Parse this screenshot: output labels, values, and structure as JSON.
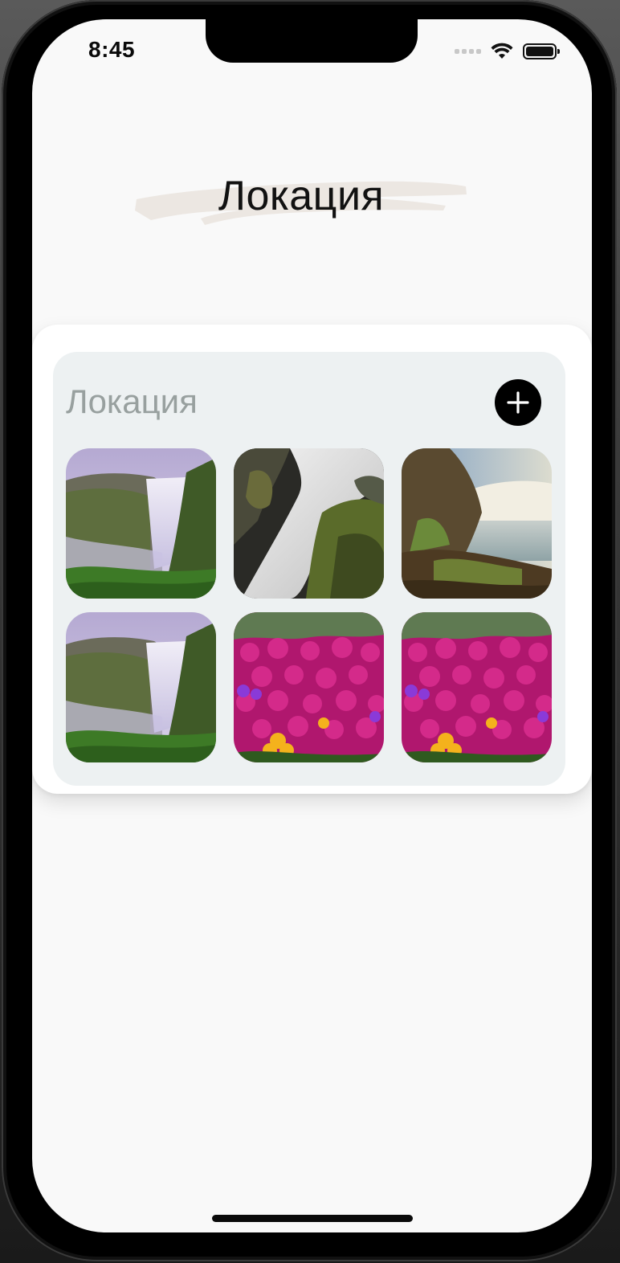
{
  "status_bar": {
    "time": "8:45"
  },
  "header": {
    "title": "Локация"
  },
  "location_card": {
    "title": "Локация",
    "add_button_icon": "plus-icon",
    "photos": [
      {
        "subject": "misty waterfall with green cliffs"
      },
      {
        "subject": "long-exposure white water over mossy rocks"
      },
      {
        "subject": "waterfall over lake with rocky shore"
      },
      {
        "subject": "misty waterfall with green cliffs"
      },
      {
        "subject": "magenta flower field with yellow blooms"
      },
      {
        "subject": "magenta flower field with yellow blooms"
      }
    ]
  },
  "colors": {
    "screen_bg": "#f9f9f9",
    "panel_bg": "#edf1f2",
    "panel_title": "#98a09f",
    "accent": "#000000"
  }
}
